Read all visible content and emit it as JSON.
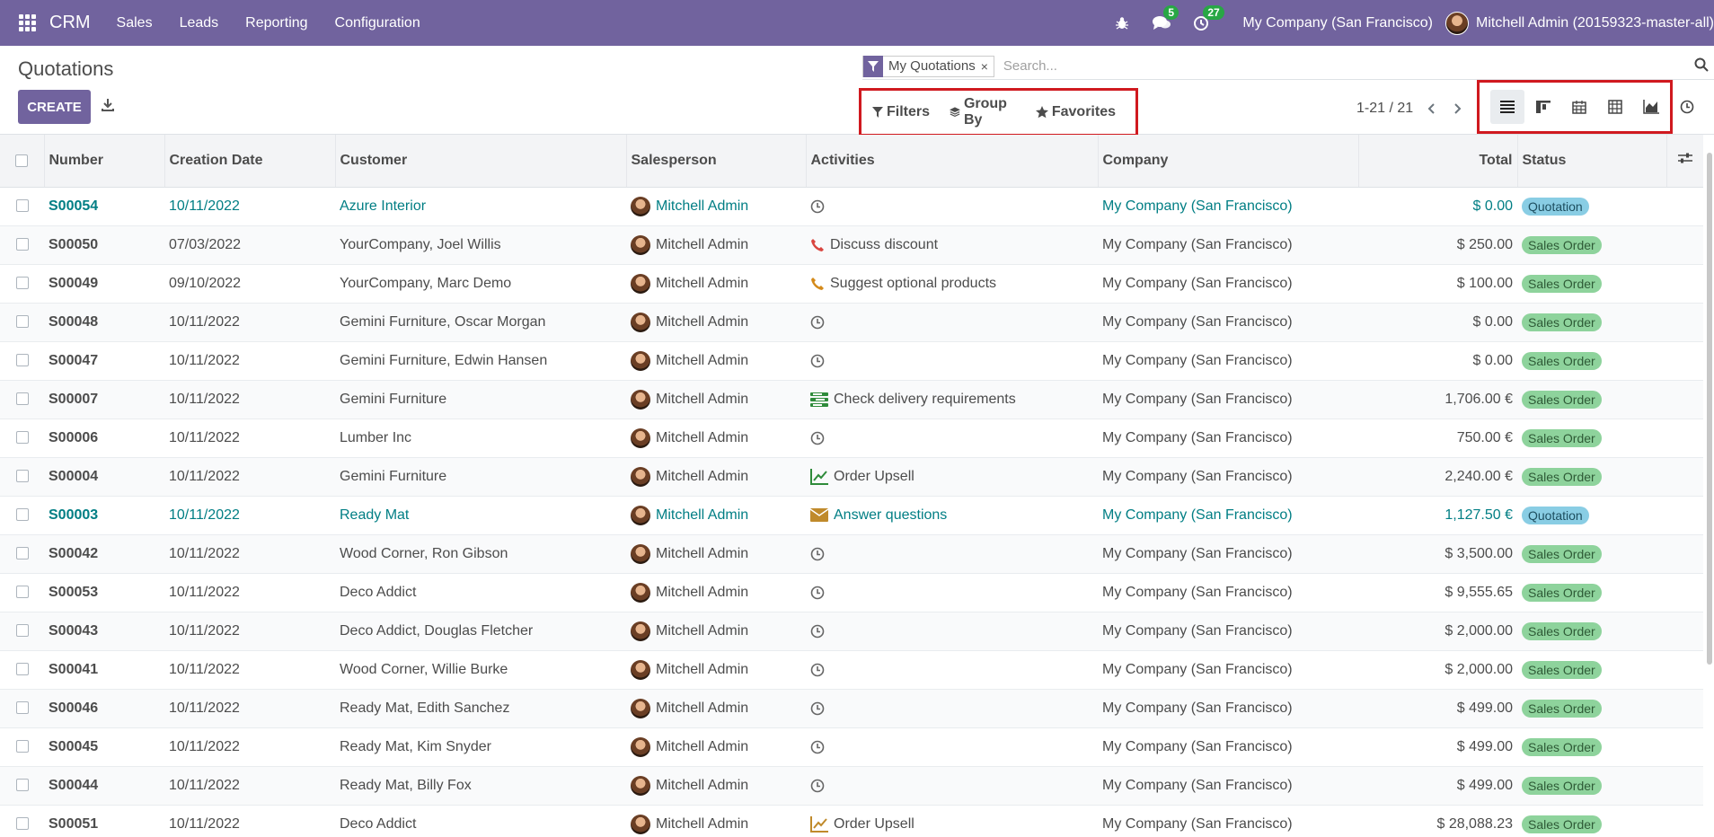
{
  "navbar": {
    "brand": "CRM",
    "menu": [
      "Sales",
      "Leads",
      "Reporting",
      "Configuration"
    ],
    "messages_count": "5",
    "activities_count": "27",
    "company": "My Company (San Francisco)",
    "user": "Mitchell Admin (20159323-master-all)"
  },
  "control_panel": {
    "title": "Quotations",
    "create_label": "CREATE",
    "facet_value": "My Quotations",
    "facet_close": "×",
    "search_placeholder": "Search...",
    "filters_label": "Filters",
    "groupby_label": "Group By",
    "favorites_label": "Favorites",
    "pager": "1-21 / 21"
  },
  "table": {
    "columns": {
      "number": "Number",
      "date": "Creation Date",
      "customer": "Customer",
      "salesperson": "Salesperson",
      "activities": "Activities",
      "company": "Company",
      "total": "Total",
      "status": "Status"
    },
    "rows": [
      {
        "number": "S00054",
        "date": "10/11/2022",
        "customer": "Azure Interior",
        "salesperson": "Mitchell Admin",
        "activity": "",
        "activity_icon": "clock-icon",
        "company": "My Company (San Francisco)",
        "total": "$ 0.00",
        "status": "Quotation"
      },
      {
        "number": "S00050",
        "date": "07/03/2022",
        "customer": "YourCompany, Joel Willis",
        "salesperson": "Mitchell Admin",
        "activity": "Discuss discount",
        "activity_icon": "phone-red-icon",
        "company": "My Company (San Francisco)",
        "total": "$ 250.00",
        "status": "Sales Order"
      },
      {
        "number": "S00049",
        "date": "09/10/2022",
        "customer": "YourCompany, Marc Demo",
        "salesperson": "Mitchell Admin",
        "activity": "Suggest optional products",
        "activity_icon": "phone-orange-icon",
        "company": "My Company (San Francisco)",
        "total": "$ 100.00",
        "status": "Sales Order"
      },
      {
        "number": "S00048",
        "date": "10/11/2022",
        "customer": "Gemini Furniture, Oscar Morgan",
        "salesperson": "Mitchell Admin",
        "activity": "",
        "activity_icon": "clock-icon",
        "company": "My Company (San Francisco)",
        "total": "$ 0.00",
        "status": "Sales Order"
      },
      {
        "number": "S00047",
        "date": "10/11/2022",
        "customer": "Gemini Furniture, Edwin Hansen",
        "salesperson": "Mitchell Admin",
        "activity": "",
        "activity_icon": "clock-icon",
        "company": "My Company (San Francisco)",
        "total": "$ 0.00",
        "status": "Sales Order"
      },
      {
        "number": "S00007",
        "date": "10/11/2022",
        "customer": "Gemini Furniture",
        "salesperson": "Mitchell Admin",
        "activity": "Check delivery requirements",
        "activity_icon": "tasks-icon",
        "company": "My Company (San Francisco)",
        "total": "1,706.00 €",
        "status": "Sales Order"
      },
      {
        "number": "S00006",
        "date": "10/11/2022",
        "customer": "Lumber Inc",
        "salesperson": "Mitchell Admin",
        "activity": "",
        "activity_icon": "clock-icon",
        "company": "My Company (San Francisco)",
        "total": "750.00 €",
        "status": "Sales Order"
      },
      {
        "number": "S00004",
        "date": "10/11/2022",
        "customer": "Gemini Furniture",
        "salesperson": "Mitchell Admin",
        "activity": "Order Upsell",
        "activity_icon": "upsell-green-icon",
        "company": "My Company (San Francisco)",
        "total": "2,240.00 €",
        "status": "Sales Order"
      },
      {
        "number": "S00003",
        "date": "10/11/2022",
        "customer": "Ready Mat",
        "salesperson": "Mitchell Admin",
        "activity": "Answer questions",
        "activity_icon": "envelope-icon",
        "company": "My Company (San Francisco)",
        "total": "1,127.50 €",
        "status": "Quotation"
      },
      {
        "number": "S00042",
        "date": "10/11/2022",
        "customer": "Wood Corner, Ron Gibson",
        "salesperson": "Mitchell Admin",
        "activity": "",
        "activity_icon": "clock-icon",
        "company": "My Company (San Francisco)",
        "total": "$ 3,500.00",
        "status": "Sales Order"
      },
      {
        "number": "S00053",
        "date": "10/11/2022",
        "customer": "Deco Addict",
        "salesperson": "Mitchell Admin",
        "activity": "",
        "activity_icon": "clock-icon",
        "company": "My Company (San Francisco)",
        "total": "$ 9,555.65",
        "status": "Sales Order"
      },
      {
        "number": "S00043",
        "date": "10/11/2022",
        "customer": "Deco Addict, Douglas Fletcher",
        "salesperson": "Mitchell Admin",
        "activity": "",
        "activity_icon": "clock-icon",
        "company": "My Company (San Francisco)",
        "total": "$ 2,000.00",
        "status": "Sales Order"
      },
      {
        "number": "S00041",
        "date": "10/11/2022",
        "customer": "Wood Corner, Willie Burke",
        "salesperson": "Mitchell Admin",
        "activity": "",
        "activity_icon": "clock-icon",
        "company": "My Company (San Francisco)",
        "total": "$ 2,000.00",
        "status": "Sales Order"
      },
      {
        "number": "S00046",
        "date": "10/11/2022",
        "customer": "Ready Mat, Edith Sanchez",
        "salesperson": "Mitchell Admin",
        "activity": "",
        "activity_icon": "clock-icon",
        "company": "My Company (San Francisco)",
        "total": "$ 499.00",
        "status": "Sales Order"
      },
      {
        "number": "S00045",
        "date": "10/11/2022",
        "customer": "Ready Mat, Kim Snyder",
        "salesperson": "Mitchell Admin",
        "activity": "",
        "activity_icon": "clock-icon",
        "company": "My Company (San Francisco)",
        "total": "$ 499.00",
        "status": "Sales Order"
      },
      {
        "number": "S00044",
        "date": "10/11/2022",
        "customer": "Ready Mat, Billy Fox",
        "salesperson": "Mitchell Admin",
        "activity": "",
        "activity_icon": "clock-icon",
        "company": "My Company (San Francisco)",
        "total": "$ 499.00",
        "status": "Sales Order"
      },
      {
        "number": "S00051",
        "date": "10/11/2022",
        "customer": "Deco Addict",
        "salesperson": "Mitchell Admin",
        "activity": "Order Upsell",
        "activity_icon": "upsell-orange-icon",
        "company": "My Company (San Francisco)",
        "total": "$ 28,088.23",
        "status": "Sales Order"
      }
    ]
  },
  "colors": {
    "brand": "#71639e",
    "link": "#017e84",
    "sales_order_tag": "#8ed39c",
    "quotation_tag": "#89cde4",
    "highlight_box": "#d0191f"
  }
}
